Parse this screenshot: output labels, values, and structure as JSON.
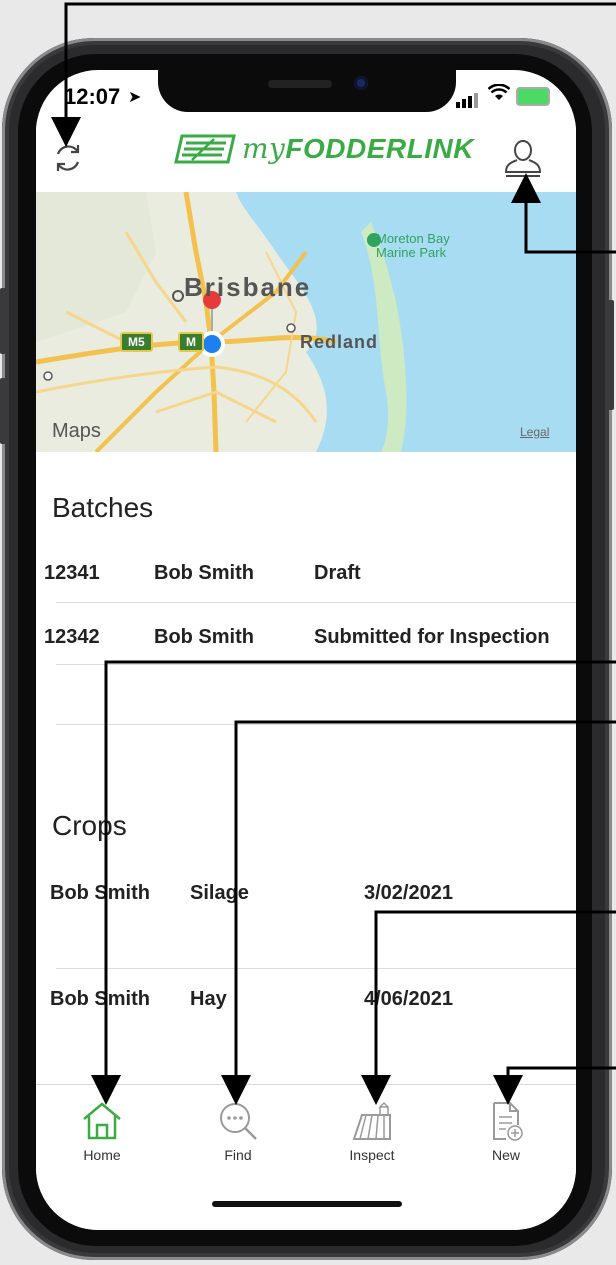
{
  "status": {
    "time": "12:07"
  },
  "header": {
    "logo_my": "my",
    "logo_fodder": "FODDERLINK"
  },
  "map": {
    "city": "Brisbane",
    "suburb": "Redland",
    "park_line1": "Moreton Bay",
    "park_line2": "Marine Park",
    "road_badge_1": "M5",
    "road_badge_2": "M",
    "brand": "Maps",
    "legal": "Legal"
  },
  "batches": {
    "title": "Batches",
    "rows": [
      {
        "id": "12341",
        "name": "Bob Smith",
        "status": "Draft"
      },
      {
        "id": "12342",
        "name": "Bob Smith",
        "status": "Submitted for Inspection"
      }
    ]
  },
  "crops": {
    "title": "Crops",
    "rows": [
      {
        "name": "Bob Smith",
        "type": "Silage",
        "date": "3/02/2021"
      },
      {
        "name": "Bob Smith",
        "type": "Hay",
        "date": "4/06/2021"
      }
    ]
  },
  "tabs": [
    {
      "label": "Home",
      "active": true
    },
    {
      "label": "Find"
    },
    {
      "label": "Inspect"
    },
    {
      "label": "New"
    }
  ],
  "colors": {
    "brand_green": "#3aab45",
    "water": "#a8dcf2",
    "land": "#e9ecdf"
  }
}
